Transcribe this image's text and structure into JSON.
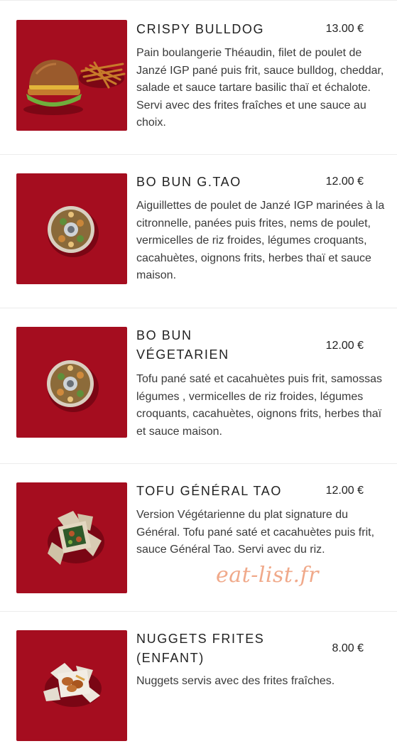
{
  "items": [
    {
      "name": "CRISPY BULLDOG",
      "price": "13.00 €",
      "description": "Pain boulangerie Théaudin, filet de poulet de Janzé IGP pané puis frit, sauce bulldog, cheddar, salade et sauce tartare basilic thaï et échalote. Servi avec des frites fraîches et une sauce au choix."
    },
    {
      "name": "BO BUN G.TAO",
      "price": "12.00 €",
      "description": "Aiguillettes de poulet de Janzé IGP marinées à la citronnelle, panées puis frites, nems de poulet, vermicelles de riz froides, légumes croquants, cacahuètes, oignons frits, herbes thaï et sauce maison."
    },
    {
      "name": "BO BUN VÉGETARIEN",
      "price": "12.00 €",
      "description": "Tofu pané saté et cacahuètes puis frit, samossas légumes , vermicelles de riz froides, légumes croquants, cacahuètes, oignons frits, herbes thaï et sauce maison."
    },
    {
      "name": "TOFU GÉNÉRAL TAO",
      "price": "12.00 €",
      "description": "Version Végétarienne du plat signature du Général. Tofu pané saté et cacahuètes puis frit, sauce Général Tao. Servi avec du riz."
    },
    {
      "name": "NUGGETS FRITES (ENFANT)",
      "price": "8.00 €",
      "description": "Nuggets servis avec des frites fraîches."
    }
  ],
  "watermark": "eat-list.fr",
  "colors": {
    "photo_background": "#9e0a1c",
    "watermark": "#f0a98a"
  }
}
